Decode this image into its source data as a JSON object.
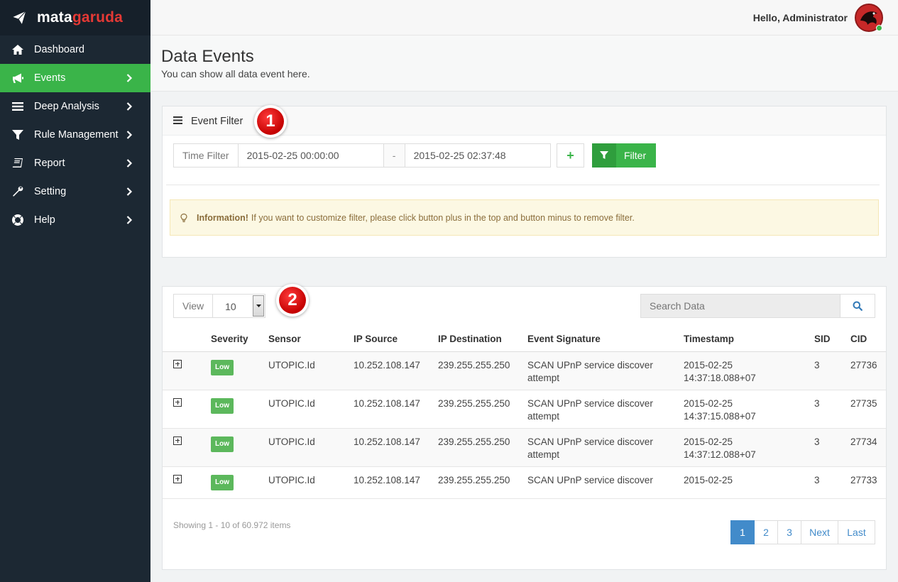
{
  "brand": {
    "part1": "mata",
    "part2": "garuda",
    "color_primary": "#ffffff",
    "color_accent": "#e53935"
  },
  "sidebar": {
    "items": [
      {
        "label": "Dashboard",
        "icon": "home-icon",
        "chevron": false,
        "active": false
      },
      {
        "label": "Events",
        "icon": "megaphone-icon",
        "chevron": true,
        "active": true
      },
      {
        "label": "Deep Analysis",
        "icon": "bars-icon",
        "chevron": true,
        "active": false
      },
      {
        "label": "Rule Management",
        "icon": "filter-icon",
        "chevron": true,
        "active": false
      },
      {
        "label": "Report",
        "icon": "book-icon",
        "chevron": true,
        "active": false
      },
      {
        "label": "Setting",
        "icon": "wrench-icon",
        "chevron": true,
        "active": false
      },
      {
        "label": "Help",
        "icon": "lifebuoy-icon",
        "chevron": true,
        "active": false
      }
    ],
    "active_color": "#3ab449"
  },
  "topbar": {
    "greeting": "Hello, Administrator",
    "avatar_icon": "garuda-avatar-icon"
  },
  "page": {
    "title": "Data Events",
    "subtitle": "You can show all data event here."
  },
  "filter_panel": {
    "title": "Event Filter",
    "marker": "1",
    "time_filter_label": "Time Filter",
    "date_from": "2015-02-25 00:00:00",
    "separator": "-",
    "date_to": "2015-02-25 02:37:48",
    "add_label": "+",
    "filter_button": "Filter",
    "alert_strong": "Information!",
    "alert_text": "If you want to customize filter, please click button plus in the top and button minus to remove filter."
  },
  "table_panel": {
    "marker": "2",
    "view_label": "View",
    "view_value": "10",
    "search_placeholder": "Search Data",
    "columns": [
      "Severity",
      "Sensor",
      "IP Source",
      "IP Destination",
      "Event Signature",
      "Timestamp",
      "SID",
      "CID"
    ],
    "rows": [
      {
        "severity": "Low",
        "sensor": "UTOPIC.Id",
        "ip_src": "10.252.108.147",
        "ip_dst": "239.255.255.250",
        "sig_line1": "SCAN UPnP service discover",
        "sig_line2": "attempt",
        "ts_line1": "2015-02-25",
        "ts_line2": "14:37:18.088+07",
        "sid": "3",
        "cid": "27736"
      },
      {
        "severity": "Low",
        "sensor": "UTOPIC.Id",
        "ip_src": "10.252.108.147",
        "ip_dst": "239.255.255.250",
        "sig_line1": "SCAN UPnP service discover",
        "sig_line2": "attempt",
        "ts_line1": "2015-02-25",
        "ts_line2": "14:37:15.088+07",
        "sid": "3",
        "cid": "27735"
      },
      {
        "severity": "Low",
        "sensor": "UTOPIC.Id",
        "ip_src": "10.252.108.147",
        "ip_dst": "239.255.255.250",
        "sig_line1": "SCAN UPnP service discover",
        "sig_line2": "attempt",
        "ts_line1": "2015-02-25",
        "ts_line2": "14:37:12.088+07",
        "sid": "3",
        "cid": "27734"
      },
      {
        "severity": "Low",
        "sensor": "UTOPIC.Id",
        "ip_src": "10.252.108.147",
        "ip_dst": "239.255.255.250",
        "sig_line1": "SCAN UPnP service discover",
        "sig_line2": "",
        "ts_line1": "2015-02-25",
        "ts_line2": "",
        "sid": "3",
        "cid": "27733"
      }
    ],
    "showing": "Showing 1 - 10 of 60.972 items",
    "pagination": [
      "1",
      "2",
      "3",
      "Next",
      "Last"
    ],
    "active_page": "1",
    "severity_color": "#5cb85c",
    "pager_active_color": "#428bca"
  }
}
